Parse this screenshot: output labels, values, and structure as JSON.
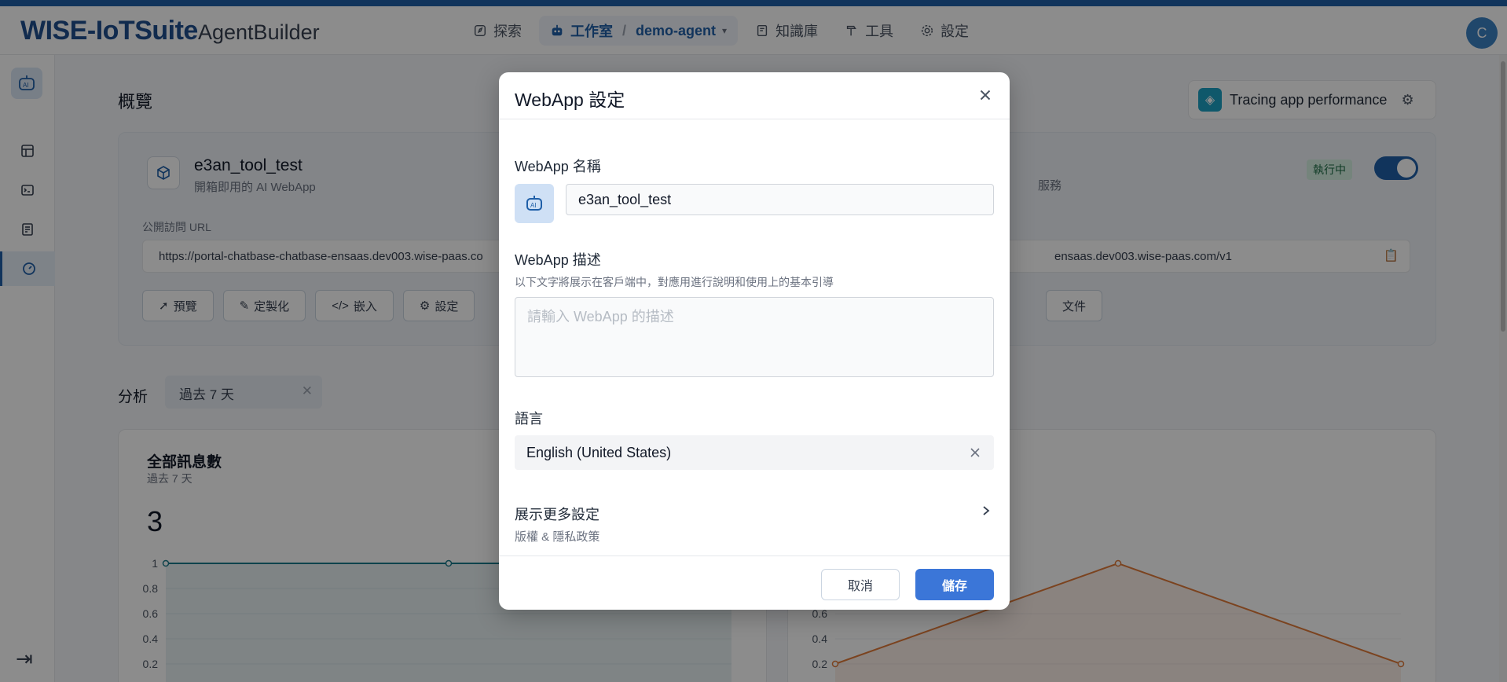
{
  "header": {
    "brand": "WISE-IoTSuite",
    "product": "AgentBuilder",
    "nav": {
      "explore": "探索",
      "studio": "工作室",
      "agent": "demo-agent",
      "knowledge": "知識庫",
      "tools": "工具",
      "settings": "設定"
    },
    "avatar_initial": "C"
  },
  "background": {
    "overview_title": "概覽",
    "tracing_label": "Tracing app performance",
    "app_name": "e3an_tool_test",
    "app_subtitle": "開箱即用的 AI WebApp",
    "url_label": "公開訪問 URL",
    "url_left": "https://portal-chatbase-chatbase-ensaas.dev003.wise-paas.co",
    "url_right": "ensaas.dev003.wise-paas.com/v1",
    "right_sub": "服務",
    "running_badge": "執行中",
    "buttons": {
      "preview": "預覽",
      "customize": "定製化",
      "embed": "嵌入",
      "settings": "設定",
      "docs": "文件"
    },
    "analysis_label": "分析",
    "period": "過去 7 天",
    "chart1": {
      "title": "全部訊息數",
      "subtitle": "過去 7 天",
      "total": "3"
    }
  },
  "chart_data": [
    {
      "type": "line",
      "ylim": [
        0,
        1
      ],
      "y_ticks": [
        "1",
        "0.8",
        "0.6",
        "0.4",
        "0.2"
      ],
      "series": [
        {
          "values": [
            1,
            1,
            1
          ]
        }
      ],
      "color": "#1b7a8a"
    },
    {
      "type": "area",
      "y_ticks": [
        "0.6",
        "0.4",
        "0.2"
      ],
      "series": [
        {
          "values": [
            0.2,
            1,
            0.2
          ]
        }
      ],
      "color": "#e07a3a"
    }
  ],
  "modal": {
    "title": "WebApp 設定",
    "name_label": "WebApp 名稱",
    "name_value": "e3an_tool_test",
    "desc_label": "WebApp 描述",
    "desc_help": "以下文字將展示在客戶端中，對應用進行說明和使用上的基本引導",
    "desc_placeholder": "請輸入 WebApp 的描述",
    "lang_label": "語言",
    "lang_value": "English (United States)",
    "more_title": "展示更多設定",
    "more_sub": "版權 & 隱私政策",
    "cancel": "取消",
    "save": "儲存"
  }
}
